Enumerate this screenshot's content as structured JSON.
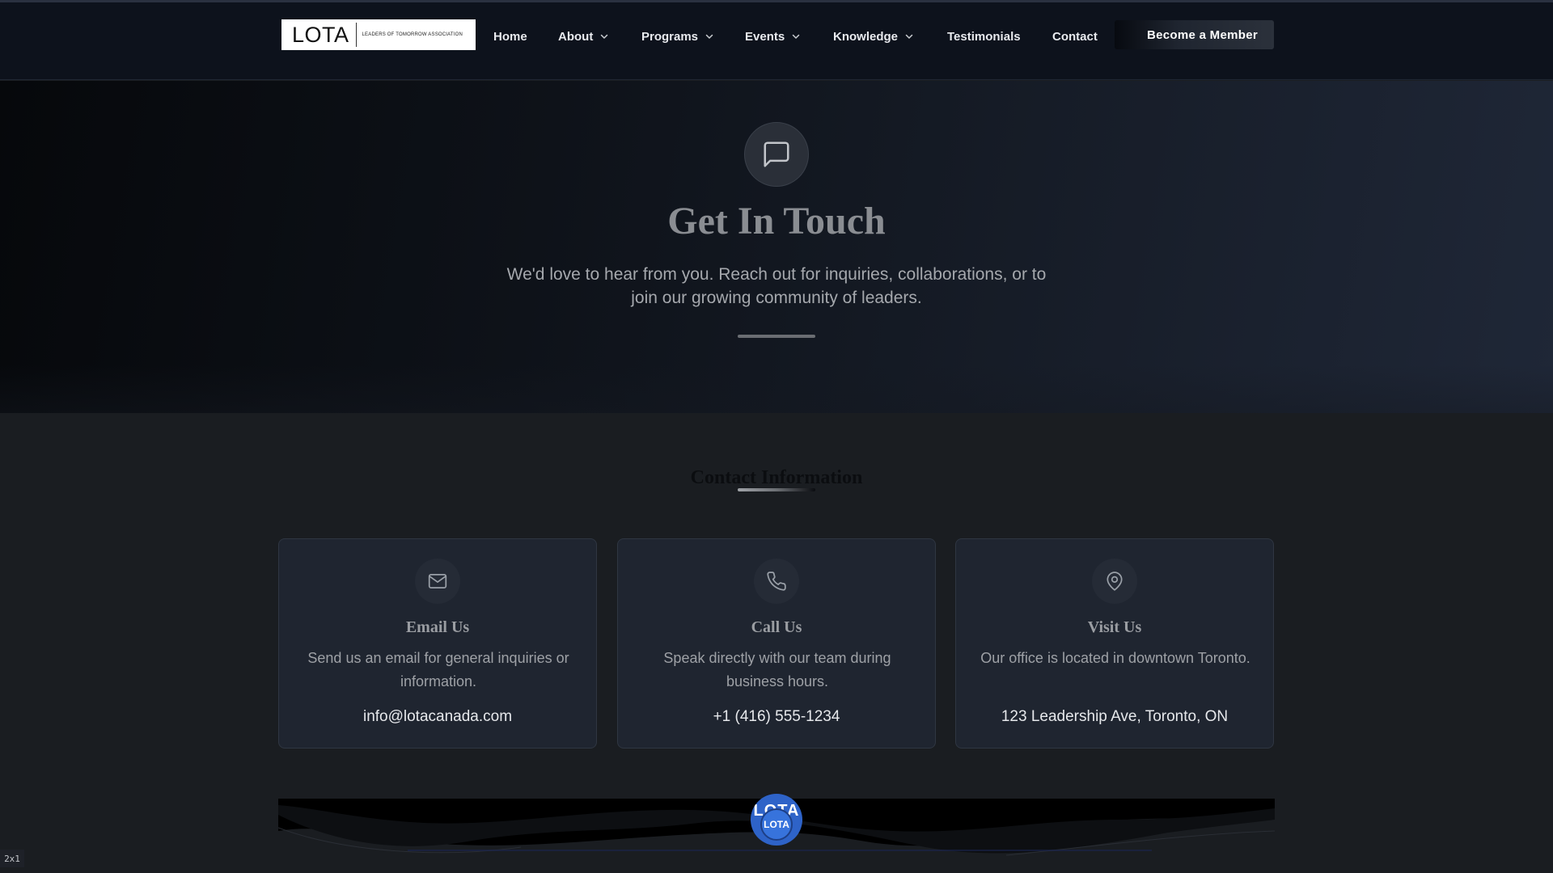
{
  "nav": {
    "logo_main": "LOTA",
    "logo_sub": "LEADERS OF TOMORROW ASSOCIATION",
    "items": [
      {
        "label": "Home",
        "has_dropdown": false
      },
      {
        "label": "About",
        "has_dropdown": true
      },
      {
        "label": "Programs",
        "has_dropdown": true
      },
      {
        "label": "Events",
        "has_dropdown": true
      },
      {
        "label": "Knowledge",
        "has_dropdown": true
      },
      {
        "label": "Testimonials",
        "has_dropdown": false
      },
      {
        "label": "Contact",
        "has_dropdown": false
      }
    ],
    "cta_label": "Become a Member"
  },
  "hero": {
    "icon": "message-square-icon",
    "title": "Get In Touch",
    "subtitle": "We'd love to hear from you. Reach out for inquiries, collaborations, or to join our growing community of leaders."
  },
  "contact": {
    "section_title": "Contact Information",
    "cards": [
      {
        "icon": "mail-icon",
        "title": "Email Us",
        "description": "Send us an email for general inquiries or information.",
        "value": "info@lotacanada.com"
      },
      {
        "icon": "phone-icon",
        "title": "Call Us",
        "description": "Speak directly with our team during business hours.",
        "value": "+1 (416) 555-1234"
      },
      {
        "icon": "map-pin-icon",
        "title": "Visit Us",
        "description": "Our office is located in downtown Toronto.",
        "value": "123 Leadership Ave, Toronto, ON"
      }
    ]
  },
  "footer": {
    "logo_text": "LOTA"
  },
  "corner_tag": "2x1",
  "colors": {
    "nav_bg": "#0d121c",
    "card_bg": "#1f2530",
    "page_bg": "#1a1d21",
    "footer_badge": "#2e63c8"
  }
}
